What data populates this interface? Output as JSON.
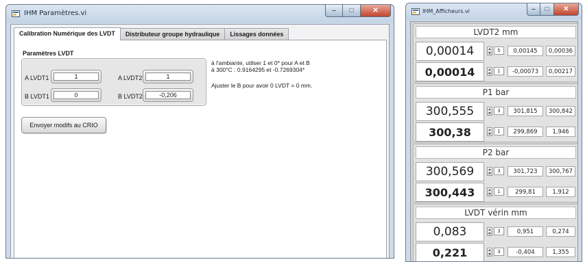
{
  "settings_window": {
    "title": "IHM Paramètres.vi",
    "tabs": [
      {
        "label": "Calibration Numérique des LVDT",
        "active": true
      },
      {
        "label": "Distributeur groupe hydraulique",
        "active": false
      },
      {
        "label": "Lissages données",
        "active": false
      }
    ],
    "group_title": "Paramètres LVDT",
    "fields": {
      "a_lvdt1": {
        "label": "A LVDT1",
        "value": "1"
      },
      "a_lvdt2": {
        "label": "A LVDT2",
        "value": "1"
      },
      "b_lvdt1": {
        "label": "B LVDT1",
        "value": "0"
      },
      "b_lvdt2": {
        "label": "B LVDT2",
        "value": "-0,206"
      }
    },
    "notes": {
      "line1": "à l'ambiante, utilser 1 et 0* pour A et B",
      "line2": "à 300°C : 0.9164295 et -0.7269304*",
      "line3": "Ajuster le B pour avoir 0 LVDT = 0 mm."
    },
    "send_button": "Envoyer modifs au CRIO"
  },
  "display_window": {
    "title": "IHM_Afficheurs.vi",
    "panels": [
      {
        "header": "LVDT2 mm",
        "row1": {
          "big": "0,00014",
          "precision": "5",
          "val_a": "0,00145",
          "val_b": "0,00036"
        },
        "row2": {
          "big": "0,00014",
          "precision": "1",
          "val_a": "-0,00073",
          "val_b": "0,00217"
        }
      },
      {
        "header": "P1 bar",
        "row1": {
          "big": "300,555",
          "precision": "3",
          "val_a": "301,815",
          "val_b": "300,842"
        },
        "row2": {
          "big": "300,38",
          "precision": "1",
          "val_a": "299,869",
          "val_b": "1,946"
        }
      },
      {
        "header": "P2 bar",
        "row1": {
          "big": "300,569",
          "precision": "3",
          "val_a": "301,723",
          "val_b": "300,767"
        },
        "row2": {
          "big": "300,443",
          "precision": "1",
          "val_a": "299,81",
          "val_b": "1,912"
        }
      },
      {
        "header": "LVDT vérin mm",
        "row1": {
          "big": "0,083",
          "precision": "3",
          "val_a": "0,951",
          "val_b": "0,274"
        },
        "row2": {
          "big": "0,221",
          "precision": "3",
          "val_a": "-0,404",
          "val_b": "1,355"
        }
      }
    ]
  },
  "icons": {
    "app": "labview-vi-icon",
    "minimize": "minimize-icon",
    "maximize": "maximize-icon",
    "close": "close-icon"
  },
  "colors": {
    "close_button": "#c2452c",
    "window_frame": "#cfdbe8",
    "panel_bg": "#e2e2e2"
  }
}
